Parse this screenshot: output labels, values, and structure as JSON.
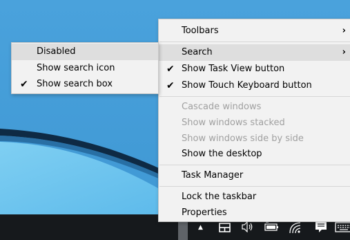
{
  "main_menu": {
    "items": [
      {
        "label": "Toolbars",
        "submenu_arrow": "›"
      },
      {
        "label": "Search",
        "submenu_arrow": "›"
      },
      {
        "label": "Show Task View button",
        "check": "✔"
      },
      {
        "label": "Show Touch Keyboard button",
        "check": "✔"
      },
      {
        "label": "Cascade windows"
      },
      {
        "label": "Show windows stacked"
      },
      {
        "label": "Show windows side by side"
      },
      {
        "label": "Show the desktop"
      },
      {
        "label": "Task Manager"
      },
      {
        "label": "Lock the taskbar"
      },
      {
        "label": "Properties"
      }
    ]
  },
  "search_submenu": {
    "items": [
      {
        "label": "Disabled"
      },
      {
        "label": "Show search icon"
      },
      {
        "label": "Show search box",
        "check": "✔"
      }
    ]
  },
  "taskbar": {
    "icons": {
      "chevron": "▲",
      "speaker": "🕪",
      "network": "((·",
      "notification": "▬"
    }
  },
  "colors": {
    "desktop_blue": "#4aa3dc",
    "menu_background": "#f2f2f2",
    "highlight": "#dedede",
    "disabled_text": "#a0a0a0",
    "taskbar": "#16191c"
  }
}
